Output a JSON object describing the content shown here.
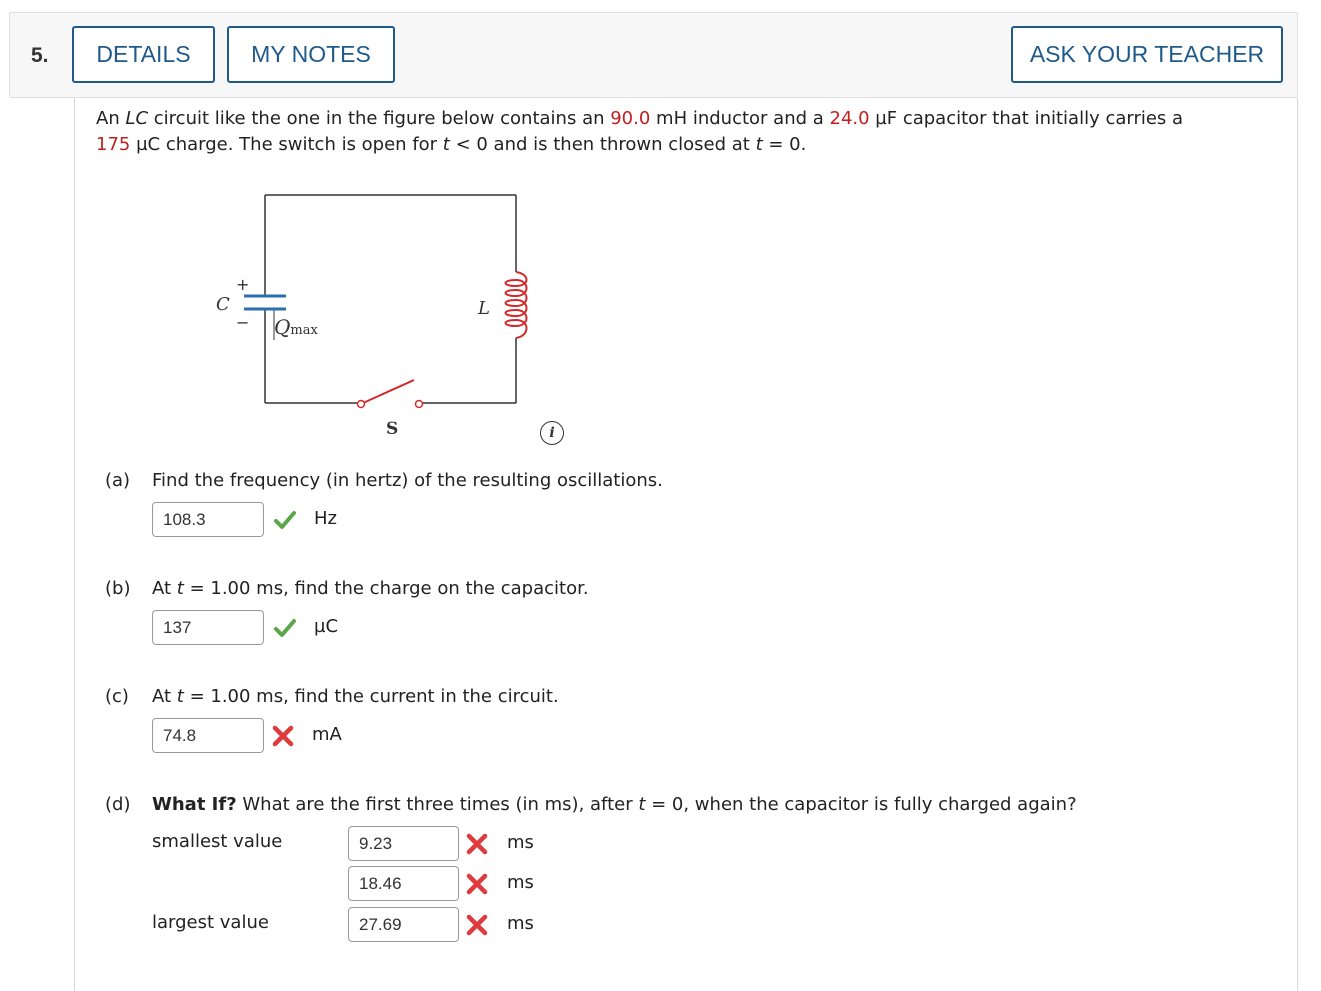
{
  "header": {
    "question_number": "5.",
    "details_label": "DETAILS",
    "notes_label": "MY NOTES",
    "ask_label": "ASK YOUR TEACHER"
  },
  "problem": {
    "t1": "An ",
    "lc": "LC",
    "t2": " circuit like the one in the figure below contains an ",
    "inductance": "90.0",
    "t3": " mH inductor and a ",
    "capacitance": "24.0",
    "t4": " µF capacitor that initially carries a",
    "charge": "175",
    "t5": " µC charge. The switch is open for ",
    "t_var1": "t",
    "t6": " < 0 and is then thrown closed at ",
    "t_var2": "t",
    "t7": " = 0."
  },
  "figure": {
    "cap_label": "C",
    "plus": "+",
    "minus": "−",
    "q_label": "Q",
    "q_sub": "max",
    "ind_label": "L",
    "switch_label": "S",
    "info_icon": "i"
  },
  "parts": {
    "a": {
      "label": "(a)",
      "text": "Find the frequency (in hertz) of the resulting oscillations.",
      "answer": "108.3",
      "status": "correct",
      "unit": "Hz"
    },
    "b": {
      "label": "(b)",
      "text_pre": "At ",
      "t_var": "t",
      "text_post": " = 1.00 ms, find the charge on the capacitor.",
      "answer": "137",
      "status": "correct",
      "unit": "µC"
    },
    "c": {
      "label": "(c)",
      "text_pre": "At ",
      "t_var": "t",
      "text_post": " = 1.00 ms, find the current in the circuit.",
      "answer": "74.8",
      "status": "incorrect",
      "unit": "mA"
    },
    "d": {
      "label": "(d)",
      "bold": "What If?",
      "text_pre": " What are the first three times (in ms), after ",
      "t_var": "t",
      "text_post": " = 0, when the capacitor is fully charged again?",
      "smallest_label": "smallest value",
      "largest_label": "largest value",
      "answers": [
        "9.23",
        "18.46",
        "27.69"
      ],
      "statuses": [
        "incorrect",
        "incorrect",
        "incorrect"
      ],
      "unit": "ms"
    }
  },
  "colors": {
    "accent_blue": "#1f5a8a",
    "given_red": "#c41e1e",
    "correct_green": "#5aa64b",
    "incorrect_red": "#e0393e"
  }
}
